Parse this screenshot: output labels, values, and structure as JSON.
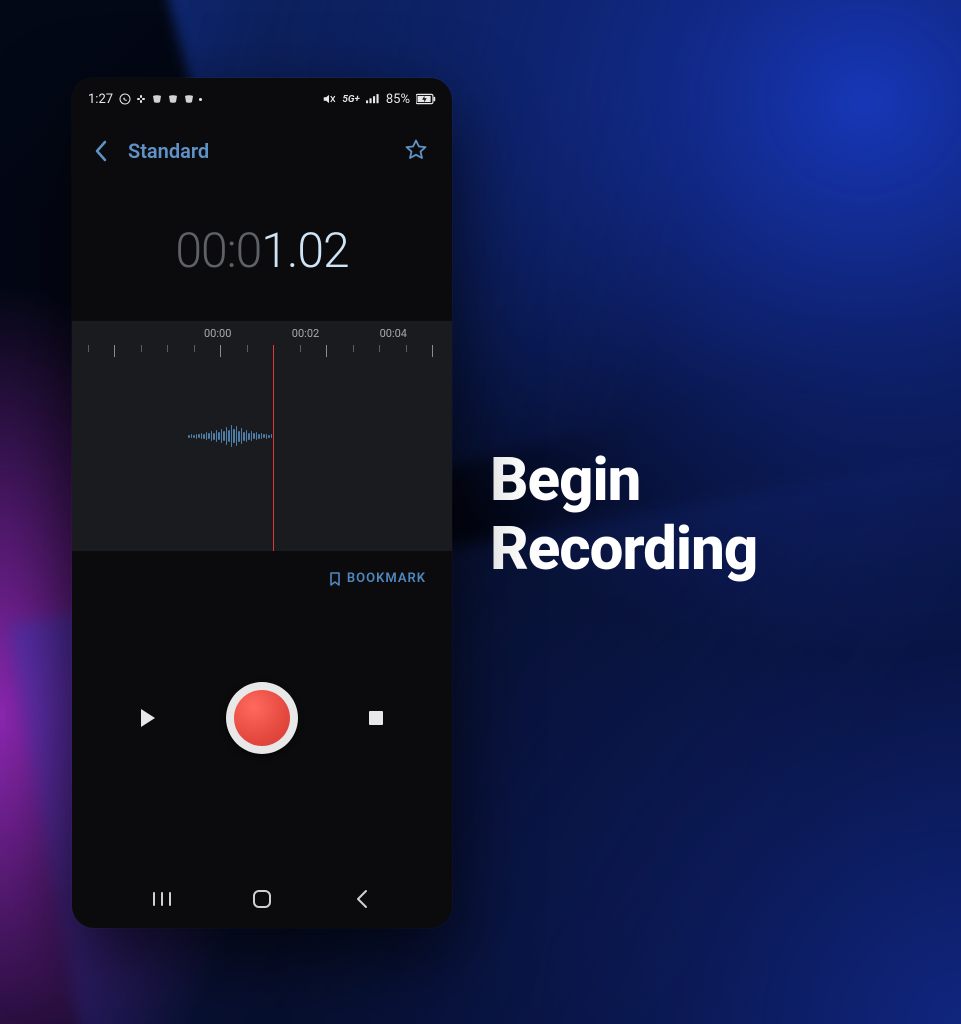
{
  "side_title_line1": "Begin",
  "side_title_line2": "Recording",
  "status": {
    "time": "1:27",
    "network": "5G+",
    "battery": "85%"
  },
  "header": {
    "title": "Standard"
  },
  "timer": {
    "dim_part": "00:0",
    "lit_part": "1.02"
  },
  "timeline": {
    "labels": [
      "00:00",
      "00:02",
      "00:04"
    ],
    "playhead_sec": 1.0,
    "px_per_sec_label": "label-spacing"
  },
  "bookmark_label": "BOOKMARK"
}
